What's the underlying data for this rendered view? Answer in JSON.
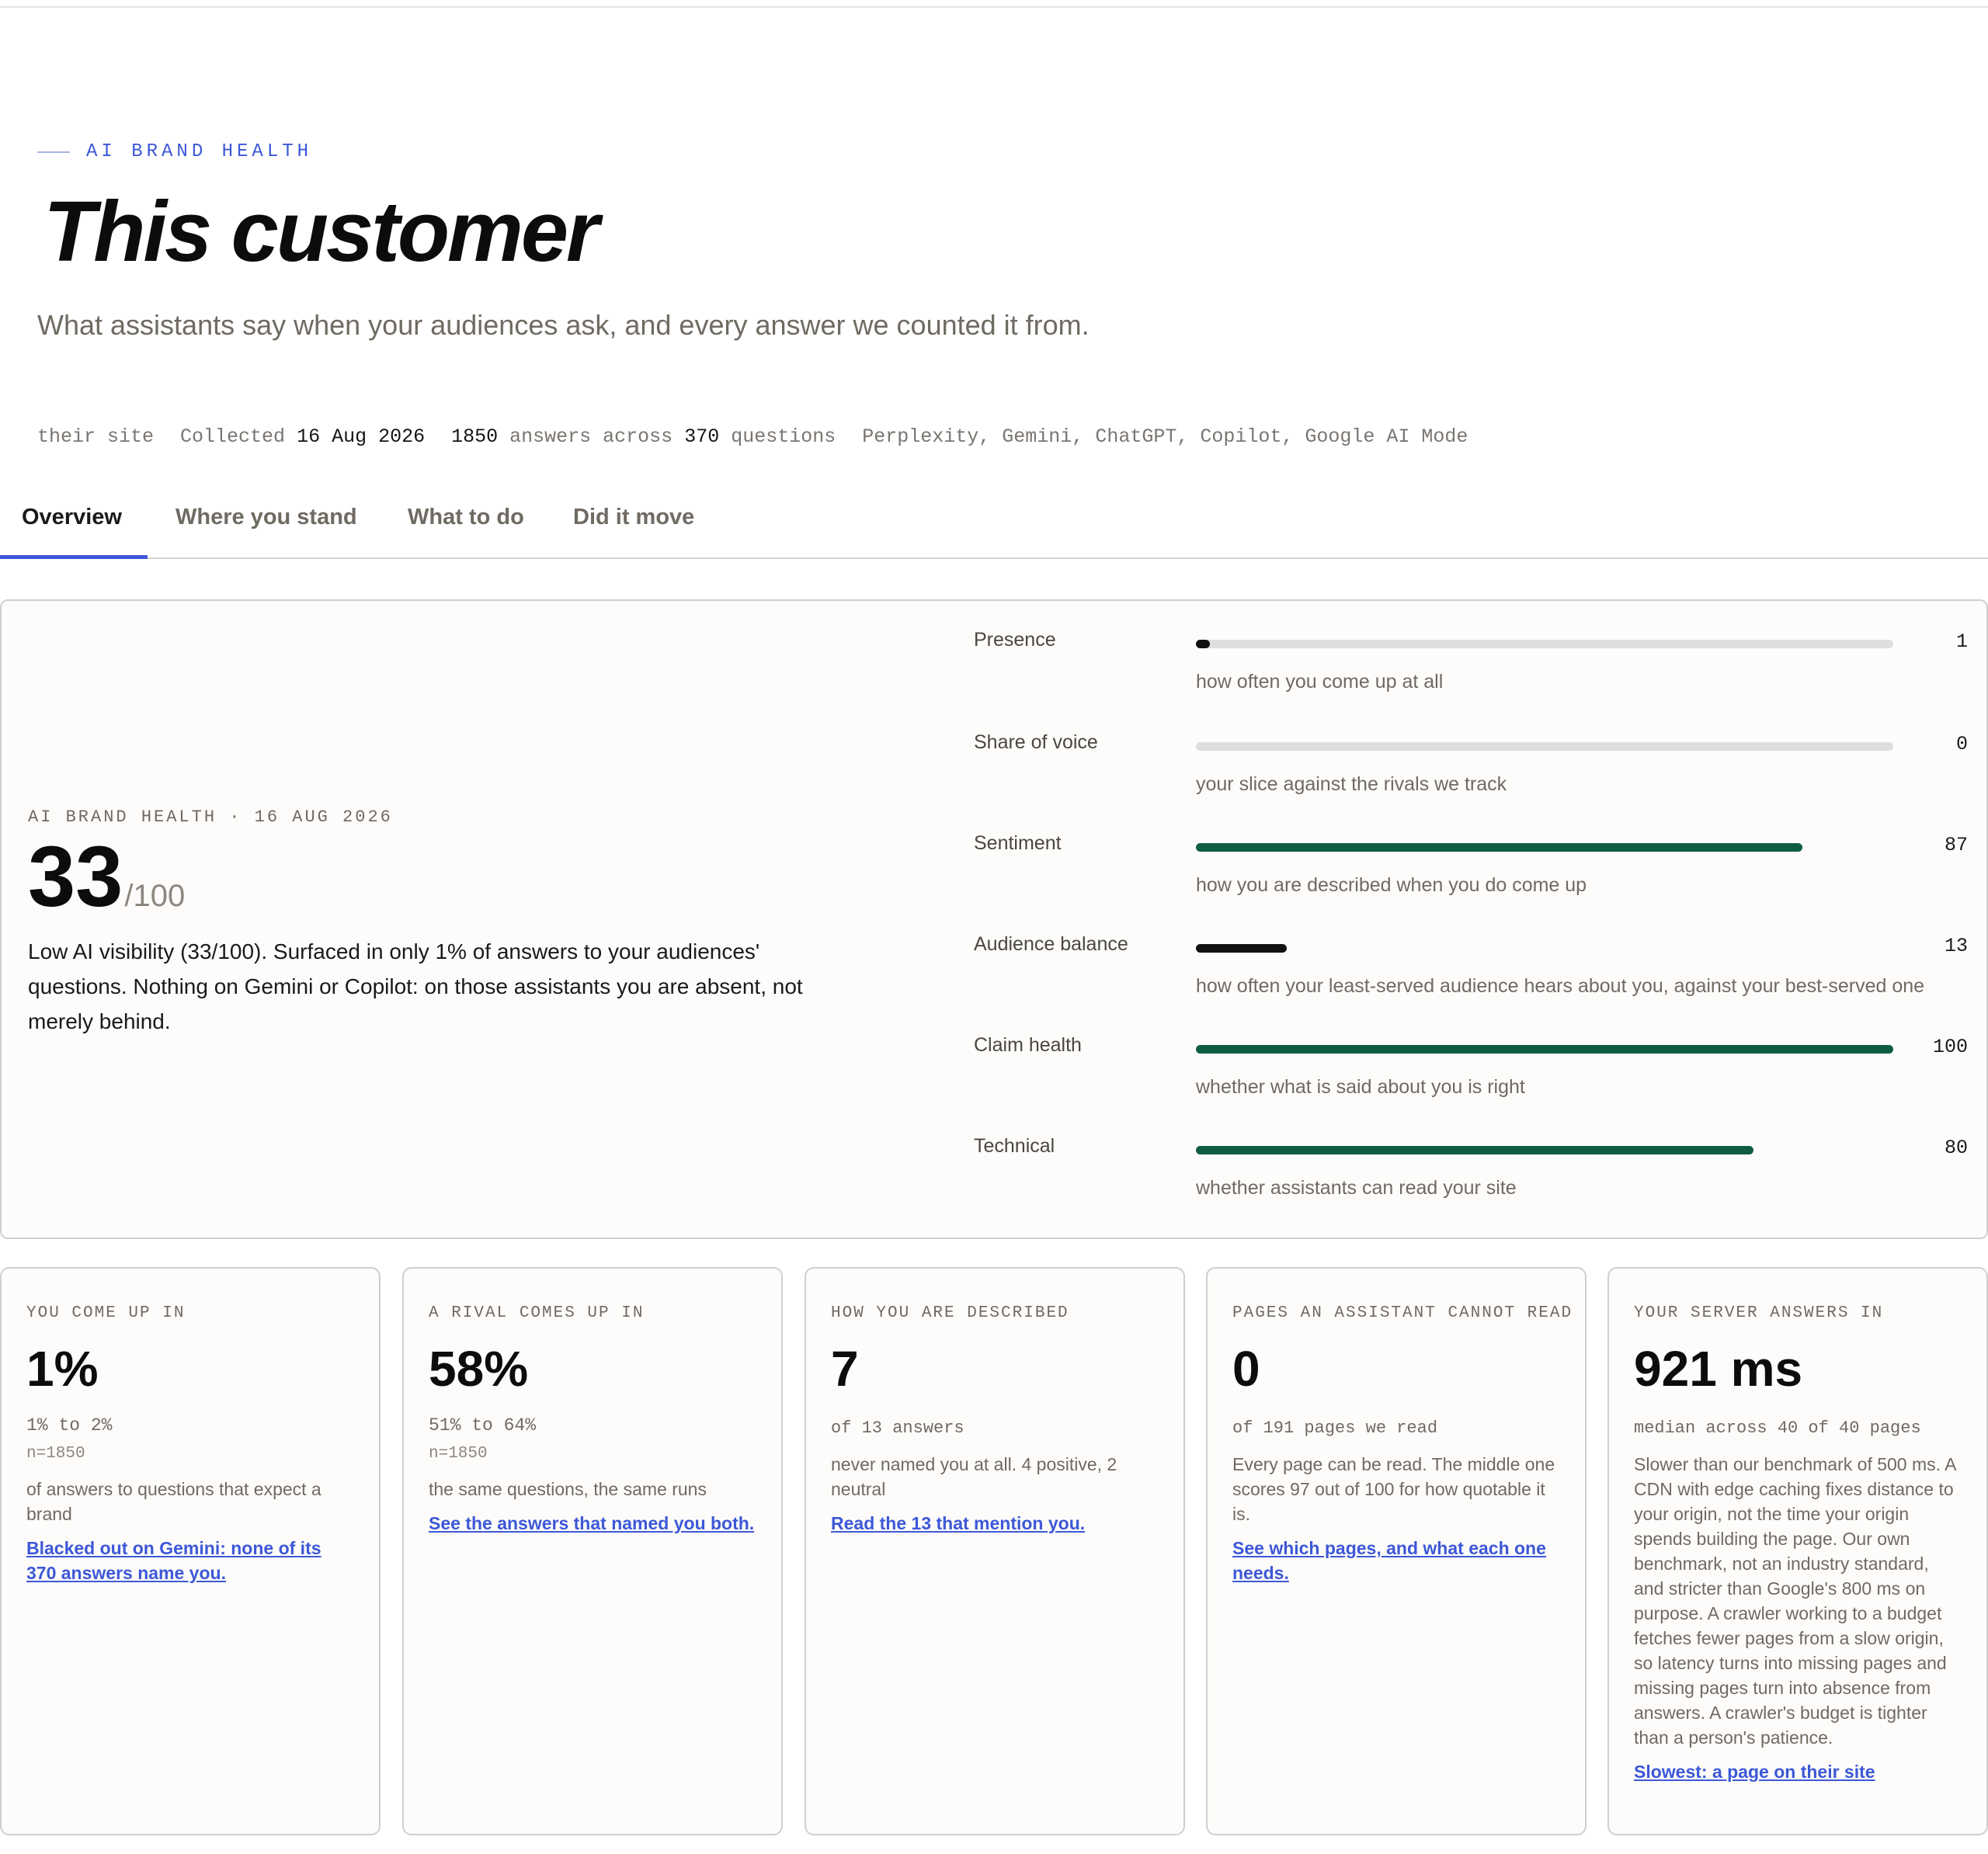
{
  "header": {
    "eyebrow": "AI BRAND HEALTH",
    "title": "This customer",
    "subtitle": "What assistants say when your audiences ask, and every answer we counted it from."
  },
  "meta": {
    "site": "their site",
    "collected_label": "Collected",
    "collected_date": "16 Aug 2026",
    "answers": "1850",
    "answers_across_label": "answers across",
    "questions": "370",
    "questions_label": "questions",
    "assistants": "Perplexity, Gemini, ChatGPT, Copilot, Google AI Mode"
  },
  "tabs": [
    {
      "label": "Overview",
      "active": true
    },
    {
      "label": "Where you stand",
      "active": false
    },
    {
      "label": "What to do",
      "active": false
    },
    {
      "label": "Did it move",
      "active": false
    }
  ],
  "score": {
    "label": "AI BRAND HEALTH · 16 AUG 2026",
    "value": "33",
    "denominator": "/100",
    "summary": "Low AI visibility (33/100). Surfaced in only 1% of answers to your audiences' questions. Nothing on Gemini or Copilot: on those assistants you are absent, not merely behind."
  },
  "metrics": [
    {
      "name": "Presence",
      "value": "1",
      "fraction": 0.01,
      "color": "#111111",
      "track": true,
      "desc": "how often you come up at all"
    },
    {
      "name": "Share of voice",
      "value": "0",
      "fraction": 0.0,
      "color": "#111111",
      "track": true,
      "desc": "your slice against the rivals we track"
    },
    {
      "name": "Sentiment",
      "value": "87",
      "fraction": 0.87,
      "color": "#0f5c45",
      "track": false,
      "desc": "how you are described when you do come up"
    },
    {
      "name": "Audience balance",
      "value": "13",
      "fraction": 0.13,
      "color": "#111111",
      "track": false,
      "desc": "how often your least-served audience hears about you, against your best-served one"
    },
    {
      "name": "Claim health",
      "value": "100",
      "fraction": 1.0,
      "color": "#0f5c45",
      "track": false,
      "desc": "whether what is said about you is right"
    },
    {
      "name": "Technical",
      "value": "80",
      "fraction": 0.8,
      "color": "#0f5c45",
      "track": false,
      "desc": "whether assistants can read your site"
    }
  ],
  "cards": [
    {
      "label": "YOU COME UP IN",
      "big": "1%",
      "range": "1% to 2%",
      "n": "n=1850",
      "text": "of answers to questions that expect a brand",
      "link": "Blacked out on Gemini: none of its 370 answers name you."
    },
    {
      "label": "A RIVAL COMES UP IN",
      "big": "58%",
      "range": "51% to 64%",
      "n": "n=1850",
      "text": "the same questions, the same runs",
      "link": "See the answers that named you both."
    },
    {
      "label": "HOW YOU ARE DESCRIBED",
      "big": "7",
      "of": "of 13 answers",
      "text": "never named you at all. 4 positive, 2 neutral",
      "link": "Read the 13 that mention you."
    },
    {
      "label": "PAGES AN ASSISTANT CANNOT READ",
      "big": "0",
      "of": "of 191 pages we read",
      "text": "Every page can be read. The middle one scores 97 out of 100 for how quotable it is.",
      "link": "See which pages, and what each one needs."
    },
    {
      "label": "YOUR SERVER ANSWERS IN",
      "big": "921 ms",
      "of": "median across 40 of 40 pages",
      "text": "Slower than our benchmark of 500 ms. A CDN with edge caching fixes distance to your origin, not the time your origin spends building the page. Our own benchmark, not an industry standard, and stricter than Google's 800 ms on purpose. A crawler working to a budget fetches fewer pages from a slow origin, so latency turns into missing pages and missing pages turn into absence from answers. A crawler's budget is tighter than a person's patience.",
      "link": "Slowest: a page on their site"
    }
  ]
}
